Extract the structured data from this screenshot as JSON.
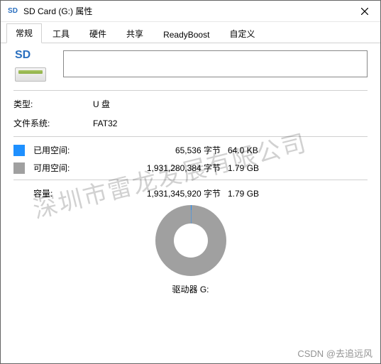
{
  "window": {
    "title": "SD Card (G:) 属性",
    "icon": "SD"
  },
  "tabs": [
    {
      "label": "常规",
      "active": true
    },
    {
      "label": "工具",
      "active": false
    },
    {
      "label": "硬件",
      "active": false
    },
    {
      "label": "共享",
      "active": false
    },
    {
      "label": "ReadyBoost",
      "active": false
    },
    {
      "label": "自定义",
      "active": false
    }
  ],
  "volume_name": "",
  "props": {
    "type_label": "类型:",
    "type_value": "U 盘",
    "fs_label": "文件系统:",
    "fs_value": "FAT32"
  },
  "space": {
    "used": {
      "label": "已用空间:",
      "bytes": "65,536 字节",
      "human": "64.0 KB",
      "color": "#1e90ff"
    },
    "free": {
      "label": "可用空间:",
      "bytes": "1,931,280,384 字节",
      "human": "1.79 GB",
      "color": "#a0a0a0"
    }
  },
  "capacity": {
    "label": "容量:",
    "bytes": "1,931,345,920 字节",
    "human": "1.79 GB"
  },
  "drive_label": "驱动器 G:",
  "chart_data": {
    "type": "pie",
    "title": "",
    "series": [
      {
        "name": "已用空间",
        "value": 65536,
        "color": "#1e90ff"
      },
      {
        "name": "可用空间",
        "value": 1931280384,
        "color": "#a0a0a0"
      }
    ]
  },
  "watermarks": {
    "company": "深圳市雷龙发展有限公司",
    "csdn": "CSDN @去追远风"
  }
}
